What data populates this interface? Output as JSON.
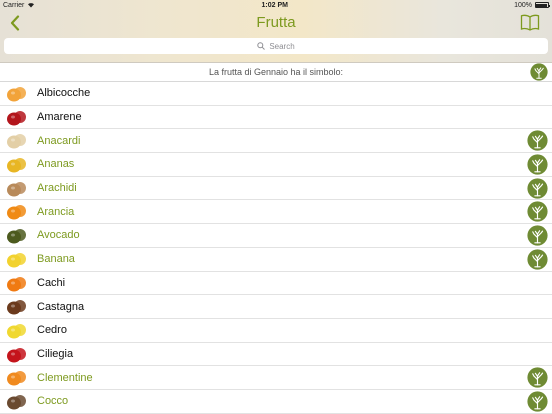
{
  "status": {
    "carrier": "Carrier",
    "time": "1:02 PM",
    "battery": "100%"
  },
  "nav": {
    "title": "Frutta"
  },
  "search": {
    "placeholder": "Search"
  },
  "info": {
    "text": "La frutta di Gennaio ha il simbolo:"
  },
  "fruits": [
    {
      "name": "Albicocche",
      "seasonal": false,
      "icon": "apricot-icon",
      "color": "#f2a33a"
    },
    {
      "name": "Amarene",
      "seasonal": false,
      "icon": "sour-cherry-icon",
      "color": "#b3151c"
    },
    {
      "name": "Anacardi",
      "seasonal": true,
      "icon": "cashew-icon",
      "color": "#e3cfa6"
    },
    {
      "name": "Ananas",
      "seasonal": true,
      "icon": "pineapple-icon",
      "color": "#e8b624"
    },
    {
      "name": "Arachidi",
      "seasonal": true,
      "icon": "peanut-icon",
      "color": "#b88a5a"
    },
    {
      "name": "Arancia",
      "seasonal": true,
      "icon": "orange-icon",
      "color": "#f08a14"
    },
    {
      "name": "Avocado",
      "seasonal": true,
      "icon": "avocado-icon",
      "color": "#4c5a1e"
    },
    {
      "name": "Banana",
      "seasonal": true,
      "icon": "banana-icon",
      "color": "#f2d22e"
    },
    {
      "name": "Cachi",
      "seasonal": false,
      "icon": "persimmon-icon",
      "color": "#f07a12"
    },
    {
      "name": "Castagna",
      "seasonal": false,
      "icon": "chestnut-icon",
      "color": "#6b3a1c"
    },
    {
      "name": "Cedro",
      "seasonal": false,
      "icon": "citron-icon",
      "color": "#f0d830"
    },
    {
      "name": "Ciliegia",
      "seasonal": false,
      "icon": "cherry-icon",
      "color": "#c4141c"
    },
    {
      "name": "Clementine",
      "seasonal": true,
      "icon": "clementine-icon",
      "color": "#f08a1e"
    },
    {
      "name": "Cocco",
      "seasonal": true,
      "icon": "coconut-icon",
      "color": "#6a4a30"
    }
  ]
}
